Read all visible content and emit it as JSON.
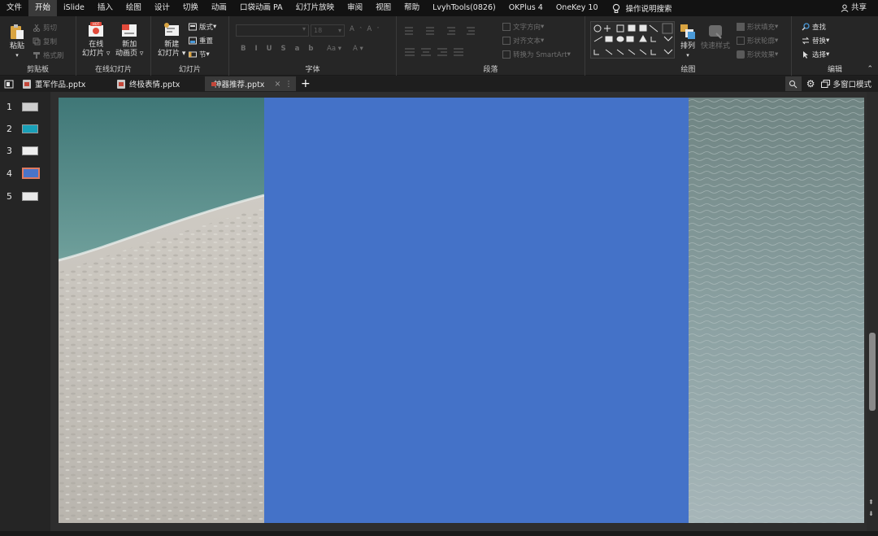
{
  "menu": {
    "tabs": [
      "文件",
      "开始",
      "iSlide",
      "插入",
      "绘图",
      "设计",
      "切换",
      "动画",
      "口袋动画 PA",
      "幻灯片放映",
      "审阅",
      "视图",
      "帮助",
      "LvyhTools(0826)",
      "OKPlus 4",
      "OneKey 10"
    ],
    "active_tab": "开始",
    "search_label": "操作说明搜索",
    "share_label": "共享"
  },
  "ribbon": {
    "clipboard": {
      "paste": "粘贴",
      "cut": "剪切",
      "copy": "复制",
      "format_painter": "格式刷",
      "label": "剪贴板"
    },
    "online_slides": {
      "online": "在线",
      "online2": "幻灯片",
      "new_anim": "新加",
      "new_anim2": "动画页",
      "hot": "HOT",
      "label": "在线幻灯片"
    },
    "slides": {
      "new_slide": "新建",
      "new_slide2": "幻灯片",
      "layout": "版式",
      "reset": "重置",
      "section": "节",
      "label": "幻灯片"
    },
    "font": {
      "size": "18",
      "label": "字体"
    },
    "paragraph": {
      "text_dir": "文字方向",
      "align_text": "对齐文本",
      "smartart": "转换为 SmartArt",
      "label": "段落"
    },
    "drawing": {
      "arrange": "排列",
      "quick_styles": "快速样式",
      "fill": "形状填充",
      "outline": "形状轮廓",
      "effects": "形状效果",
      "label": "绘图"
    },
    "editing": {
      "find": "查找",
      "replace": "替换",
      "select": "选择",
      "label": "编辑"
    }
  },
  "doc_tabs": [
    {
      "name": "董军作品.pptx",
      "active": false
    },
    {
      "name": "终极表情.pptx",
      "active": false
    },
    {
      "name": "神器推荐.pptx",
      "active": true
    }
  ],
  "multi_window": "多窗口模式",
  "slides_list": [
    {
      "num": "1",
      "active": false,
      "thumb": "#cfcfcf"
    },
    {
      "num": "2",
      "active": false,
      "thumb": "#19a0b8"
    },
    {
      "num": "3",
      "active": false,
      "thumb": "#eeeeee"
    },
    {
      "num": "4",
      "active": true,
      "thumb": "#4a74c9"
    },
    {
      "num": "5",
      "active": false,
      "thumb": "#e9e9e9"
    }
  ],
  "colors": {
    "slide_blue": "#4472C8",
    "accent": "#e07a5f"
  }
}
